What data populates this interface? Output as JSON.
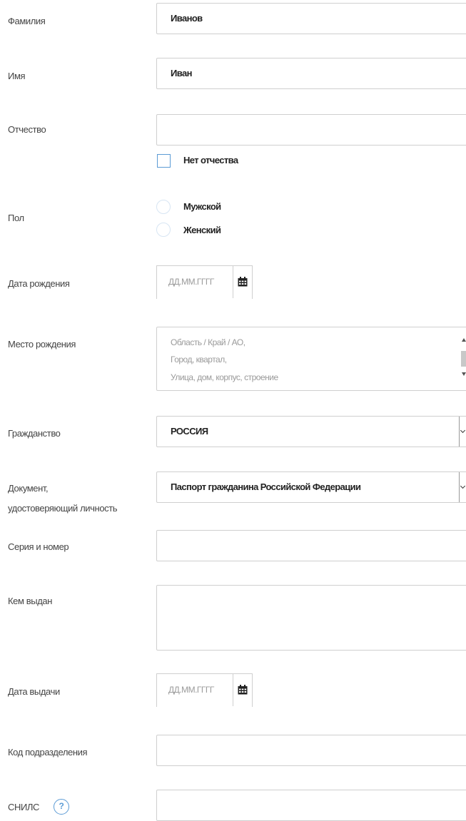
{
  "fields": {
    "surname": {
      "label": "Фамилия",
      "value": "Иванов"
    },
    "name": {
      "label": "Имя",
      "value": "Иван"
    },
    "patronymic": {
      "label": "Отчество",
      "value": "",
      "no_patronymic_label": "Нет отчества",
      "no_patronymic_checked": false
    },
    "gender": {
      "label": "Пол",
      "options": [
        "Мужской",
        "Женский"
      ],
      "selected": null
    },
    "birth_date": {
      "label": "Дата рождения",
      "placeholder": "ДД.ММ.ГГГГ",
      "icon": "calendar-icon"
    },
    "birth_place": {
      "label": "Место рождения",
      "placeholder_lines": [
        "Область / Край / АО,",
        "Город, квартал,",
        "Улица, дом, корпус, строение"
      ]
    },
    "citizenship": {
      "label": "Гражданство",
      "value": "РОССИЯ"
    },
    "id_document": {
      "label_line1": "Документ,",
      "label_line2": "удостоверяющий личность",
      "value": "Паспорт гражданина Российской Федерации"
    },
    "series_number": {
      "label": "Серия и номер",
      "value": ""
    },
    "issued_by": {
      "label": "Кем выдан",
      "value": ""
    },
    "issue_date": {
      "label": "Дата выдачи",
      "placeholder": "ДД.ММ.ГГГГ",
      "icon": "calendar-icon"
    },
    "division_code": {
      "label": "Код подразделения",
      "value": ""
    },
    "snils": {
      "label": "СНИЛС",
      "help_symbol": "?",
      "value": ""
    }
  },
  "colors": {
    "accent": "#5b9bd5",
    "border": "#cfcfcf",
    "label": "#444444"
  }
}
